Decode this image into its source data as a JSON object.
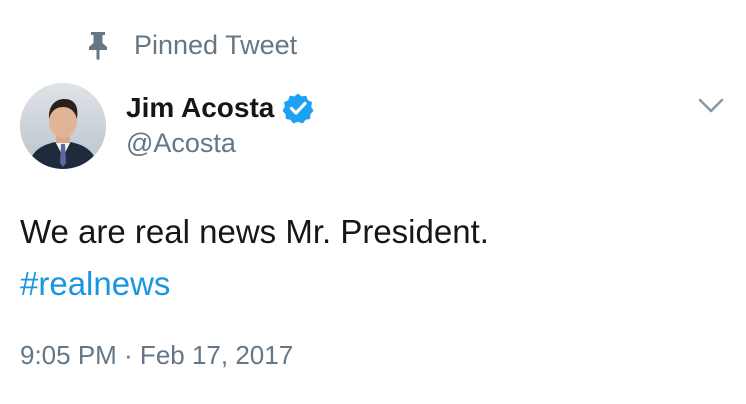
{
  "pinned": {
    "label": "Pinned Tweet",
    "icon": "pin-icon"
  },
  "author": {
    "name": "Jim Acosta",
    "handle": "@Acosta",
    "verified": true,
    "verified_icon": "verified-badge-icon"
  },
  "tweet": {
    "text": "We are real news Mr. President.",
    "hashtag": "#realnews",
    "timestamp": "9:05 PM · Feb 17, 2017"
  },
  "menu": {
    "icon": "chevron-down-icon"
  },
  "colors": {
    "link": "#1b95e0",
    "secondary_text": "#657786",
    "primary_text": "#14171a",
    "verified": "#1da1f2"
  }
}
